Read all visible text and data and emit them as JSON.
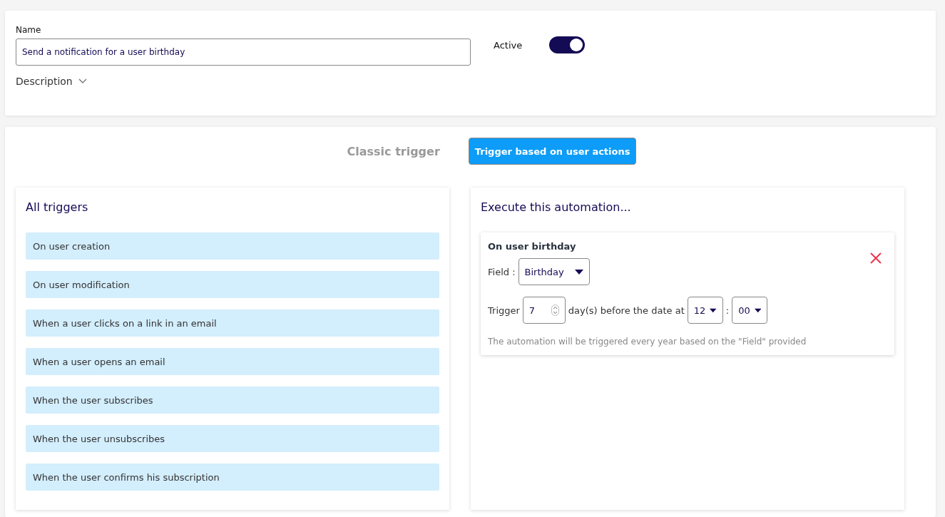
{
  "name_field": {
    "label": "Name",
    "value": "Send a notification for a user birthday"
  },
  "active": {
    "label": "Active",
    "on": true
  },
  "description": {
    "label": "Description",
    "expanded": false
  },
  "tabs": [
    {
      "label": "Classic trigger",
      "selected": false
    },
    {
      "label": "Trigger based on user actions",
      "selected": true
    }
  ],
  "all_triggers": {
    "title": "All triggers",
    "items": [
      "On user creation",
      "On user modification",
      "When a user clicks on a link in an email",
      "When a user opens an email",
      "When the user subscribes",
      "When the user unsubscribes",
      "When the user confirms his subscription"
    ]
  },
  "execute": {
    "title": "Execute this automation...",
    "card": {
      "title": "On user birthday",
      "field_label": "Field :",
      "field_value": "Birthday",
      "trigger_label": "Trigger",
      "days_value": "7",
      "days_text": "day(s) before the date at",
      "hour": "12",
      "separator": ":",
      "minute": "00",
      "note": "The automation will be triggered every year based on the \"Field\" provided"
    }
  }
}
